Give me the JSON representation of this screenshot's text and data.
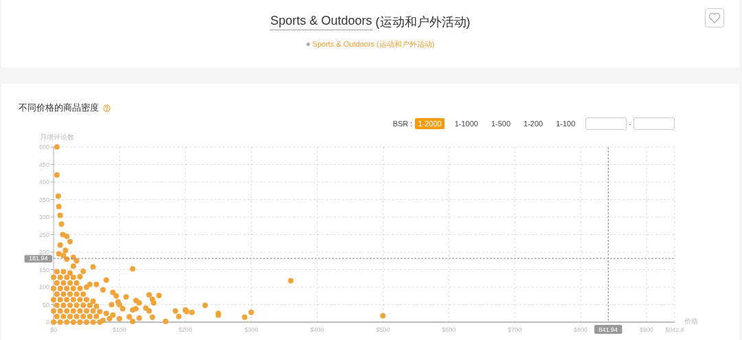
{
  "header": {
    "title": "Sports & Outdoors",
    "title_suffix": "(运动和户外活动)",
    "favorited": false,
    "breadcrumb": [
      "Sports & Outdoors (运动和户外活动)"
    ]
  },
  "panel": {
    "title": "不同价格的商品密度",
    "bsr_filter": {
      "label": "BSR :",
      "options": [
        {
          "label": "1-2000",
          "selected": true
        },
        {
          "label": "1-1000",
          "selected": false
        },
        {
          "label": "1-500",
          "selected": false
        },
        {
          "label": "1-200",
          "selected": false
        },
        {
          "label": "1-100",
          "selected": false
        }
      ]
    },
    "range_separator": "-",
    "chart_data": {
      "type": "scatter",
      "xlabel": "价格",
      "ylabel": "月增评论数",
      "xlim": [
        0,
        942.8
      ],
      "ylim": [
        0,
        500
      ],
      "xticks": [
        {
          "value": 0,
          "label": "$0"
        },
        {
          "value": 100,
          "label": "$100"
        },
        {
          "value": 200,
          "label": "$200"
        },
        {
          "value": 300,
          "label": "$300"
        },
        {
          "value": 400,
          "label": "$400"
        },
        {
          "value": 500,
          "label": "$500"
        },
        {
          "value": 600,
          "label": "$600"
        },
        {
          "value": 700,
          "label": "$700"
        },
        {
          "value": 800,
          "label": "$800"
        },
        {
          "value": 900,
          "label": "$900"
        },
        {
          "value": 942.8,
          "label": "$942.8"
        }
      ],
      "yticks": [
        0,
        50,
        100,
        150,
        200,
        250,
        300,
        350,
        400,
        450,
        500
      ],
      "x": [
        0,
        10,
        20,
        30,
        40,
        50,
        60,
        70,
        5,
        15,
        25,
        35,
        45,
        55,
        65,
        0,
        10,
        20,
        30,
        40,
        50,
        60,
        5,
        15,
        25,
        35,
        45,
        55,
        0,
        10,
        20,
        30,
        40,
        50,
        5,
        15,
        25,
        35,
        45,
        0,
        10,
        20,
        30,
        40,
        5,
        15,
        25,
        35,
        0,
        10,
        20,
        30,
        5,
        15,
        5,
        5,
        7,
        8,
        10,
        12,
        14,
        20,
        25,
        10,
        18,
        8,
        15,
        20,
        30,
        35,
        60,
        120,
        45,
        25,
        40,
        80,
        30,
        55,
        65,
        50,
        75,
        90,
        95,
        110,
        145,
        160,
        125,
        130,
        150,
        152,
        98,
        100,
        88,
        60,
        105,
        120,
        125,
        140,
        145,
        185,
        190,
        200,
        202,
        210,
        230,
        250,
        250,
        290,
        300,
        360,
        500,
        170,
        120,
        100,
        90,
        115,
        150,
        130,
        70,
        80,
        65,
        85,
        75
      ],
      "series": [
        {
          "color": "#f0a53c",
          "values": [
            0,
            0,
            0,
            0,
            0,
            0,
            0,
            0,
            16,
            16,
            16,
            16,
            16,
            16,
            16,
            32,
            32,
            32,
            32,
            32,
            32,
            32,
            48,
            48,
            48,
            48,
            48,
            48,
            64,
            64,
            64,
            64,
            64,
            64,
            80,
            80,
            80,
            80,
            80,
            96,
            96,
            96,
            96,
            96,
            112,
            112,
            112,
            112,
            128,
            128,
            128,
            128,
            144,
            144,
            500,
            420,
            360,
            330,
            305,
            280,
            250,
            245,
            230,
            220,
            205,
            195,
            190,
            180,
            185,
            175,
            158,
            152,
            145,
            140,
            130,
            120,
            160,
            108,
            108,
            100,
            92,
            85,
            75,
            72,
            78,
            76,
            62,
            55,
            65,
            55,
            58,
            50,
            50,
            60,
            38,
            35,
            38,
            40,
            32,
            32,
            16,
            35,
            30,
            28,
            48,
            25,
            20,
            14,
            28,
            118,
            18,
            2,
            2,
            10,
            20,
            15,
            14,
            12,
            30,
            25,
            45,
            10,
            5
          ]
        }
      ],
      "grid": true,
      "ref_lines": [
        {
          "axis": "y",
          "value": 181.94,
          "label": "181.94"
        },
        {
          "axis": "x",
          "value": 841.94,
          "label": "841.94"
        }
      ]
    }
  }
}
